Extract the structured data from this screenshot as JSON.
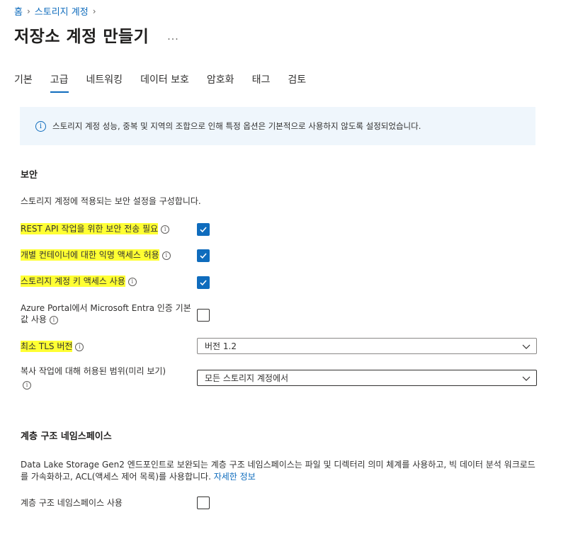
{
  "breadcrumb": {
    "home": "홈",
    "storage_accounts": "스토리지 계정"
  },
  "page": {
    "title": "저장소 계정 만들기",
    "more": "..."
  },
  "tabs": [
    {
      "label": "기본"
    },
    {
      "label": "고급"
    },
    {
      "label": "네트워킹"
    },
    {
      "label": "데이터 보호"
    },
    {
      "label": "암호화"
    },
    {
      "label": "태그"
    },
    {
      "label": "검토"
    }
  ],
  "active_tab": "고급",
  "info_banner": {
    "text": "스토리지 계정 성능, 중복 및 지역의 조합으로 인해 특정 옵션은 기본적으로 사용하지 않도록 설정되었습니다."
  },
  "security": {
    "title": "보안",
    "description": "스토리지 계정에 적용되는 보안 설정을 구성합니다.",
    "secure_transfer": {
      "label": "REST API 작업을 위한 보안 전송 필요",
      "checked": true
    },
    "anonymous_access": {
      "label": "개별 컨테이너에 대한 익명 액세스 허용",
      "checked": true
    },
    "key_access": {
      "label": "스토리지 계정 키 액세스 사용",
      "checked": true
    },
    "entra_default": {
      "label_line1": "Azure Portal에서 Microsoft Entra 인증 기본",
      "label_line2": "값 사용",
      "checked": false
    },
    "tls": {
      "label": "최소 TLS 버전",
      "value": "버전 1.2"
    },
    "copy_scope": {
      "label_line1": "복사 작업에 대해 허용된 범위(미리 보기)",
      "value": "모든 스토리지 계정에서"
    }
  },
  "hns": {
    "title": "계층 구조 네임스페이스",
    "description": "Data Lake Storage Gen2 엔드포인트로 보완되는 계층 구조 네임스페이스는 파일 및 디렉터리 의미 체계를 사용하고, 빅 데이터 분석 워크로드를 가속화하고, ACL(액세스 제어 목록)를 사용합니다.",
    "learn_more": "자세한 정보",
    "enable": {
      "label": "계층 구조 네임스페이스 사용",
      "checked": false
    }
  },
  "colors": {
    "accent": "#0f6cbd",
    "highlight": "#ffff33",
    "info_bg": "#eff6fc"
  }
}
